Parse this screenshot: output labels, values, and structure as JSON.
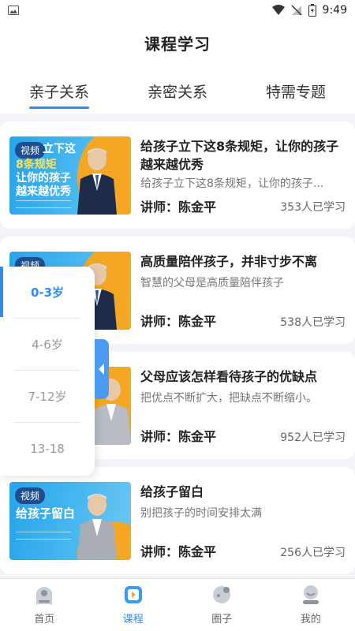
{
  "status": {
    "time": "9:49"
  },
  "header": {
    "title": "课程学习",
    "tabs": [
      {
        "label": "亲子关系",
        "active": true
      },
      {
        "label": "亲密关系",
        "active": false
      },
      {
        "label": "特需专题",
        "active": false
      }
    ]
  },
  "courses": [
    {
      "badge": "视频",
      "cover_lines": [
        "立下这",
        "8条规矩",
        "让你的孩子",
        "越来越优秀"
      ],
      "title": "给孩子立下这8条规矩，让你的孩子越来越优秀",
      "subtitle": "给孩子立下这8条规矩，让你的孩子...",
      "teacher": "讲师：陈金平",
      "count": "353人已学习"
    },
    {
      "badge": "视频",
      "title": "高质量陪伴孩子，并非寸步不离",
      "subtitle": "智慧的父母是高质量陪伴孩子",
      "teacher": "讲师：陈金平",
      "count": "538人已学习"
    },
    {
      "title": "父母应该怎样看待孩子的优缺点",
      "subtitle": "把优点不断扩大，把缺点不断缩小。",
      "teacher": "讲师：陈金平",
      "count": "952人已学习"
    },
    {
      "badge": "视频",
      "cover_lines": [
        "给孩子留白"
      ],
      "title": "给孩子留白",
      "subtitle": "别把孩子的时间安排太满",
      "teacher": "讲师：陈金平",
      "count": "256人已学习"
    }
  ],
  "age_filter": {
    "items": [
      {
        "label": "0-3岁",
        "active": true
      },
      {
        "label": "4-6岁",
        "active": false
      },
      {
        "label": "7-12岁",
        "active": false
      },
      {
        "label": "13-18",
        "active": false
      }
    ]
  },
  "bottom_nav": [
    {
      "label": "首页",
      "icon": "home-icon",
      "active": false
    },
    {
      "label": "课程",
      "icon": "course-icon",
      "active": true
    },
    {
      "label": "圈子",
      "icon": "circle-icon",
      "active": false
    },
    {
      "label": "我的",
      "icon": "profile-icon",
      "active": false
    }
  ],
  "colors": {
    "accent": "#2f8bf5",
    "cover_blue": "#27a4ea",
    "cover_orange": "#f5a623"
  }
}
